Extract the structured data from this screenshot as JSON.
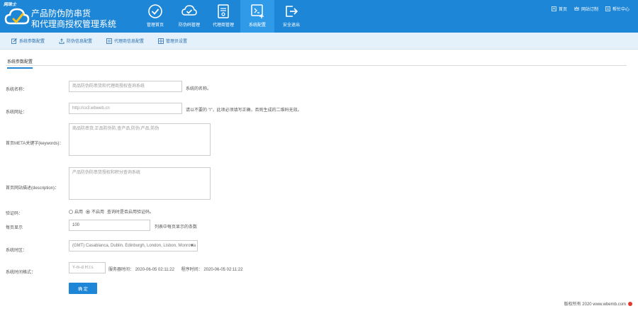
{
  "brand": {
    "tag": "网珠士",
    "title_line1": "产品防伪防串货",
    "title_line2": "和代理商授权管理系统"
  },
  "nav": [
    {
      "label": "管理首页",
      "icon": "dashboard-check-icon",
      "active": false
    },
    {
      "label": "防伪码管理",
      "icon": "cloud-check-icon",
      "active": false
    },
    {
      "label": "代理商管理",
      "icon": "document-icon",
      "active": false
    },
    {
      "label": "系统配置",
      "icon": "settings-panel-icon",
      "active": true
    },
    {
      "label": "安全退出",
      "icon": "exit-icon",
      "active": false
    }
  ],
  "topright": [
    {
      "label": "首页",
      "icon": "home-icon"
    },
    {
      "label": "网站订制",
      "icon": "crown-icon"
    },
    {
      "label": "帮忙中心",
      "icon": "help-icon"
    }
  ],
  "subbar": [
    {
      "label": "系统参数配置",
      "icon": "edit-icon"
    },
    {
      "label": "防伪信息配置",
      "icon": "upload-icon"
    },
    {
      "label": "代理商信息配置",
      "icon": "list-icon"
    },
    {
      "label": "管理员设置",
      "icon": "grid-icon"
    }
  ],
  "section_tab": "系统参数配置",
  "form": {
    "site_name_label": "系统名称：",
    "site_name_value": "商品防伪防串货和代理商授权查询系统",
    "site_name_note": "系统的名称。",
    "site_url_label": "系统网址：",
    "site_url_value": "http://cx3.wbweb.cn",
    "site_url_note": "请以不要的 \"/\"，此项必须填写正确，否则生成的二维码无效。",
    "keywords_label": "首页META关键字(keywords)：",
    "keywords_value": "商品防串货,正品防伪防,查产品,防伪,产品,防伪",
    "description_label": "首页网站描述(description)：",
    "description_value": "产品防伪防串货授权和积分查询系统",
    "captcha_label": "验证码：",
    "captcha_on": "启用",
    "captcha_off": "不启用",
    "captcha_note": "查询时是否启用验证码。",
    "page_size_label": "每页显示",
    "page_size_value": "100",
    "page_size_note": "列表中每页显示的条数",
    "timezone_label": "系统时区：",
    "timezone_value": "(GMT) Casablanca, Dublin, Edinburgh, London, Lisbon, Monrovia",
    "timeformat_label": "系统时间格式：",
    "timeformat_value": "Y-m-d H:i:s",
    "server_time_label": "服务器时间：",
    "server_time_value": "2020-06-05 02:11:22",
    "sync_time_label": "程序时间：",
    "sync_time_value": "2020-06-05 02:11:22",
    "confirm_label": "确 定"
  },
  "footer": {
    "text": "版权所有 2020 www.wbemb.com"
  }
}
